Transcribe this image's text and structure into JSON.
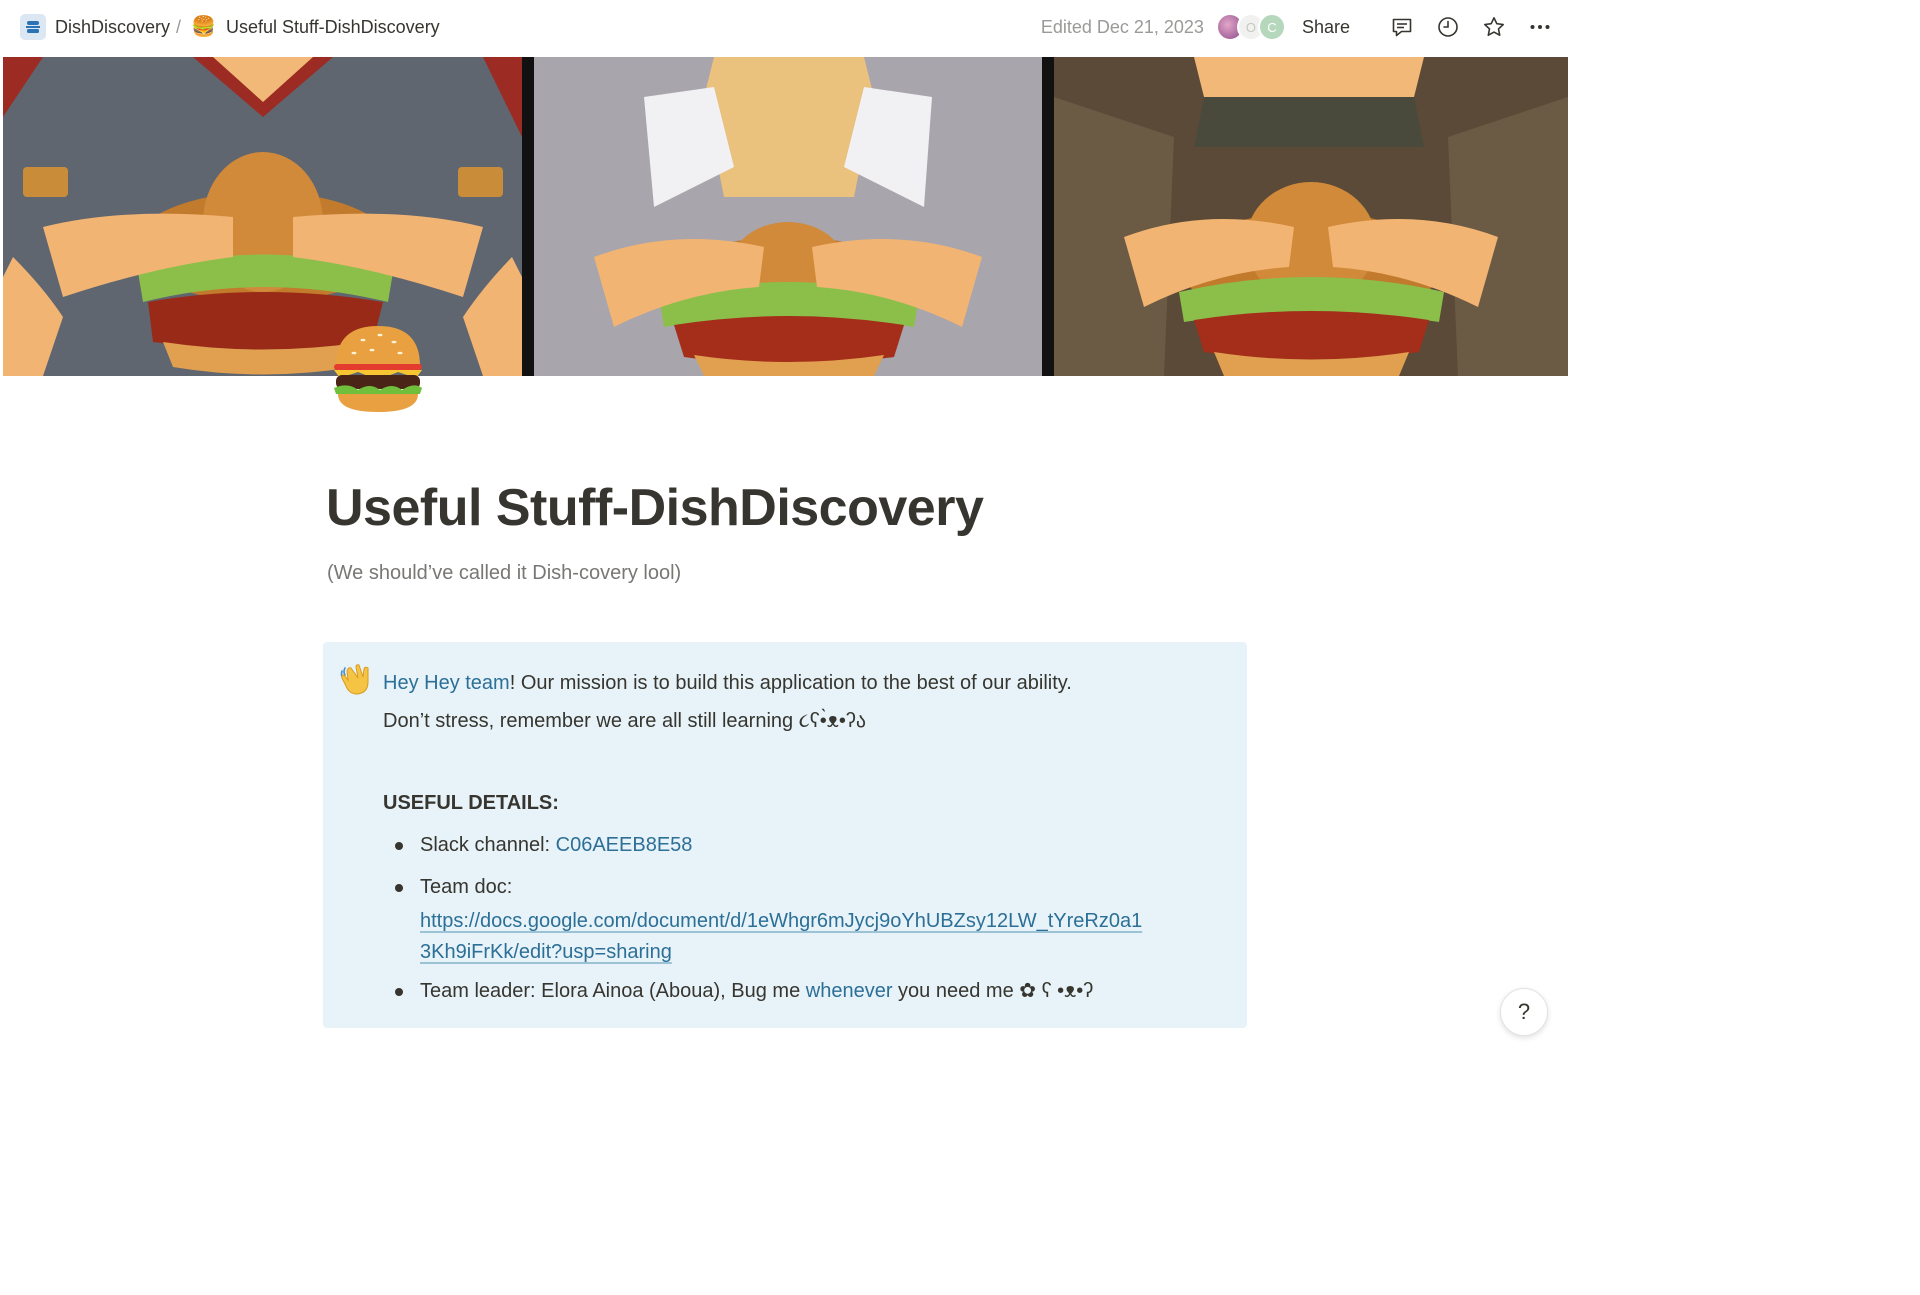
{
  "topbar": {
    "workspace": "DishDiscovery",
    "separator": "/",
    "page_emoji": "🍔",
    "page_name": "Useful Stuff-DishDiscovery",
    "edited": "Edited Dec 21, 2023",
    "avatars": [
      "",
      "O",
      "C"
    ],
    "share": "Share",
    "icons": [
      "comment-icon",
      "history-icon",
      "star-icon",
      "more-icon"
    ]
  },
  "cover": {
    "panels": 3,
    "description_colors": {
      "bun": "#c9822d",
      "lettuce": "#8cbf4a",
      "patty": "#8e2a18",
      "hands": "#f0b472"
    }
  },
  "page": {
    "icon": "burger-icon",
    "title": "Useful Stuff-DishDiscovery",
    "subtitle": "(We should’ve called it Dish-covery lool)"
  },
  "callout": {
    "icon": "waving-hand-icon",
    "line1_link": "Hey Hey team",
    "line1_rest": "! Our mission is to build this application to the best of our ability.",
    "line2": "Don’t stress, remember we are all still learning ૮ʕ•̀ᴥ•ʔა",
    "heading": "USEFUL DETAILS:",
    "slack_label": "Slack channel: ",
    "slack_value": "C06AEEB8E58",
    "teamdoc_label": "Team doc:",
    "teamdoc_url_1": "https://docs.google.com/document/d/1eWhgr6mJycj9oYhUBZsy12LW_tYreRz0a1",
    "teamdoc_url_2": "3Kh9iFrKk/edit?usp=sharing",
    "leader_pre": "Team leader: Elora Ainoa (Aboua), Bug me ",
    "leader_link": "whenever",
    "leader_post": " you need me ✿ ʕ •ᴥ•ʔ"
  },
  "help": {
    "label": "?"
  },
  "colors": {
    "link": "#2c6f97",
    "callout_bg": "#e7f3f8",
    "text": "#37352f",
    "muted": "#787774"
  }
}
